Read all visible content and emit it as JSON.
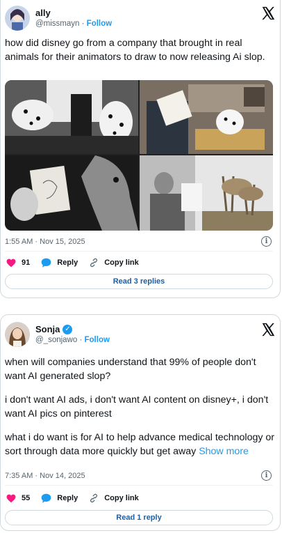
{
  "tweets": [
    {
      "author": {
        "name": "ally",
        "handle": "@missmayn",
        "follow_label": "Follow",
        "verified": false,
        "avatar_icon": "avatar-illustrated-portrait"
      },
      "text": "how did disney go from a company that brought in real animals for their animators to draw to now releasing Ai slop.",
      "show_more": "",
      "timestamp": "1:55 AM · Nov 15, 2025",
      "likes": "91",
      "reply_label": "Reply",
      "copy_link_label": "Copy link",
      "read_replies_label": "Read 3 replies",
      "media": [
        "photo-artist-drawing-dalmatians",
        "photo-animator-sketching-dalmatian-puppy",
        "photo-man-holding-drawing-with-horse",
        "photo-artist-drawing-fawns"
      ]
    },
    {
      "author": {
        "name": "Sonja",
        "handle": "@_sonjawo",
        "follow_label": "Follow",
        "verified": true,
        "avatar_icon": "avatar-photo"
      },
      "text_lines": [
        "when will companies understand that 99% of people don't want AI generated slop?",
        "i don't want AI ads, i don't want AI content on disney+, i don't want AI pics on pinterest",
        "what i do want is for AI to help advance medical technology or sort through data more quickly but get away"
      ],
      "show_more": "Show more",
      "timestamp": "7:35 AM · Nov 14, 2025",
      "likes": "55",
      "reply_label": "Reply",
      "copy_link_label": "Copy link",
      "read_replies_label": "Read 1 reply"
    }
  ],
  "colors": {
    "accent": "#1d9bf0",
    "like": "#f91880",
    "muted": "#536471",
    "border": "#cfd9de"
  }
}
